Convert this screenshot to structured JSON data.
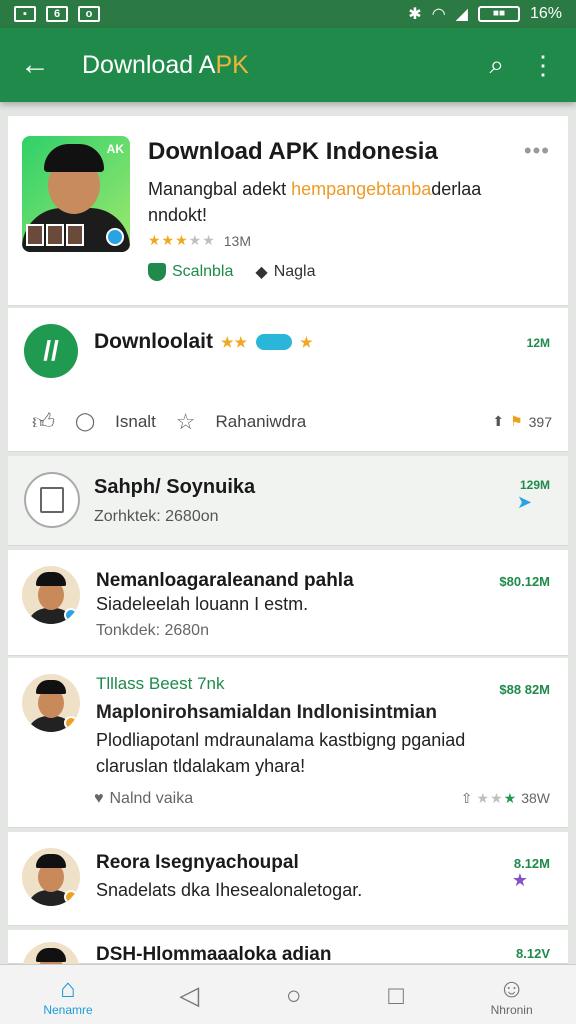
{
  "status": {
    "left_icons": [
      "image-icon",
      "6",
      "o"
    ],
    "battery": "16%"
  },
  "appbar": {
    "title_main": "Download A",
    "title_accent": "PK"
  },
  "featured": {
    "title": "Download APK Indonesia",
    "thumb_corner": "AK",
    "desc_a": "Manangbal adekt ",
    "desc_hl": "hempangebtanba",
    "desc_b": "derlaa nndokt!",
    "rating_size": "13M",
    "tag_green": "Scalnbla",
    "tag_grey": "Nagla"
  },
  "download": {
    "title": "Downloolait",
    "size": "12M",
    "action1": "Isnalt",
    "action2": "Rahaniwdra",
    "count": "397"
  },
  "safe": {
    "title": "Sahph/ Soynuika",
    "sub": "Zorhktek: 2680on",
    "size": "129M"
  },
  "items": [
    {
      "title": "Nemanloagaraleanand pahla",
      "line": "Siadeleelah louann I estm.",
      "meta": "Tonkdek: 2680n",
      "price": "$80.12M"
    },
    {
      "title": "Tlllass Beest 7nk",
      "line1": "Maplonirohsamialdan Indlonisintmian",
      "line2": "Plodliapotanl mdraunalama kastbigng pganiad",
      "line3": "claruslan tldalakam yhara!",
      "meta": "Nalnd vaika",
      "price": "$88 82M",
      "rating": "38W"
    },
    {
      "title": "Reora Isegnyachoupal",
      "line": "Snadelats dka Ihesealonaletogar.",
      "price": "8.12M"
    },
    {
      "title": "DSH-Hlommaaaloka adian",
      "price": "8.12V"
    }
  ],
  "nav": {
    "home": "Nenamre",
    "profile": "Nhronin"
  }
}
